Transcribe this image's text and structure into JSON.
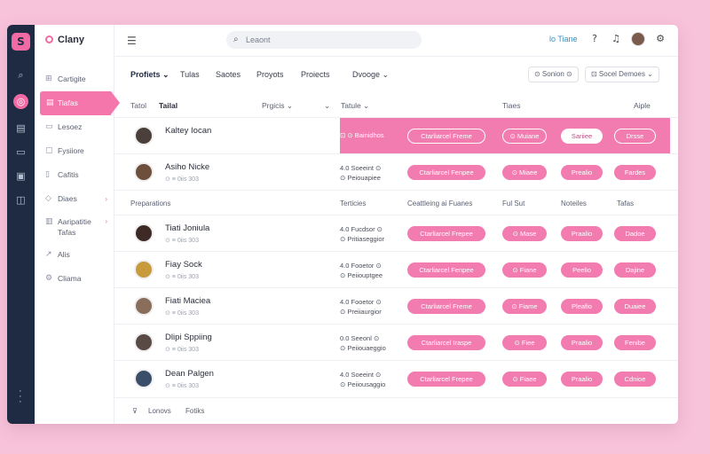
{
  "app": {
    "name": "Clany",
    "logo_letter": "S"
  },
  "topbar": {
    "search_placeholder": "Leaont",
    "link": "lo Tiane"
  },
  "sidebar": {
    "items": [
      {
        "label": "Cartigite",
        "icon": "grid-icon"
      },
      {
        "label": "Tiafas",
        "icon": "document-icon",
        "active": true
      },
      {
        "label": "Lesoez",
        "icon": "folder-icon"
      },
      {
        "label": "Fysiiore",
        "icon": "box-icon"
      },
      {
        "label": "Cafitis",
        "icon": "file-icon"
      },
      {
        "label": "Diaes",
        "icon": "tag-icon",
        "chevron": "›"
      },
      {
        "label": "Aaripatitie",
        "label2": "Tafas",
        "icon": "chart-icon",
        "chevron": "›"
      },
      {
        "label": "Alis",
        "icon": "link-icon"
      },
      {
        "label": "Cliama",
        "icon": "settings-icon"
      }
    ]
  },
  "tabs": [
    {
      "label": "Profiets ⌄",
      "active": true
    },
    {
      "label": "Tulas"
    },
    {
      "label": "Saotes"
    },
    {
      "label": "Proyots"
    },
    {
      "label": "Proiects"
    },
    {
      "label": "Dvooge ⌄"
    }
  ],
  "tab_buttons": [
    "⊙ Sonion ⊙",
    "⊡ Socel Demoes ⌄"
  ],
  "table": {
    "headers": [
      "Tatol",
      "Tailal",
      "Prgicis ⌄",
      "⌄",
      "Tatule ⌄",
      "Tiaes",
      "Aiple"
    ],
    "subheaders": [
      "Preparations",
      "Terticies",
      "Ceattleing ai Fuanes",
      "Ful Sut",
      "Noteiles",
      "Tafas"
    ],
    "footer": [
      "⊽",
      "Lonovs",
      "Fotiks"
    ],
    "rows": [
      {
        "name": "Kaltey Iocan",
        "sub": "",
        "status1": "⊡ ⊙ Bainidhos",
        "status2": "",
        "chips": [
          "Ctarliarcel Freme",
          "⊙ Muiane",
          "Sariiee",
          "Drsse"
        ],
        "highlight": true,
        "avatar_color": "#4a3f3a"
      },
      {
        "name": "Asiho Nicke",
        "sub": "⊙ ≡ 0iis 303",
        "status1": "4.0 Soeeint ⊙",
        "status2": "⊙ Peiouapiee",
        "chips": [
          "Ctarliarcel Fenpee",
          "⊙ Miaee",
          "Prealio",
          "Fardes"
        ],
        "avatar_color": "#6d4f3b"
      },
      {
        "name": "Tiati Joniula",
        "sub": "⊙ ≡ 0iis 303",
        "status1": "4.0 Fucdsor ⊙",
        "status2": "⊙ Pritiaseggior",
        "chips": [
          "Ctarliarcel Frepee",
          "⊙ Mase",
          "Praalio",
          "Dadoe"
        ],
        "avatar_color": "#3d2a27"
      },
      {
        "name": "Fiay Sock",
        "sub": "⊙ ≡ 0iis 303",
        "status1": "4.0 Fooetor ⊙",
        "status2": "⊙ Peiiouptgee",
        "chips": [
          "Ctarliarcel Fenpee",
          "⊙ Fiane",
          "Peelio",
          "Dajine"
        ],
        "avatar_color": "#c79a3b"
      },
      {
        "name": "Fiati Maciea",
        "sub": "⊙ ≡ 0iis 303",
        "status1": "4.0 Fooetor ⊙",
        "status2": "⊙ Preiiaurgior",
        "chips": [
          "Ctarliarcel Freme",
          "⊙ Fiame",
          "Pleafio",
          "Duaiee"
        ],
        "avatar_color": "#8a6e5c"
      },
      {
        "name": "Dlipi Sppiing",
        "sub": "⊙ ≡ 0iis 303",
        "status1": "0.0 Seeonl ⊙",
        "status2": "⊙ Peiiouaeggio",
        "chips": [
          "Ctarliarcel Iraspe",
          "⊙ Fiee",
          "Praalio",
          "Fenibe"
        ],
        "avatar_color": "#5a4a45"
      },
      {
        "name": "Dean Palgen",
        "sub": "⊙ ≡ 0iis 303",
        "status1": "4.0 Soeeint ⊙",
        "status2": "⊙ Peiiousaggio",
        "chips": [
          "Ctarliarcel Frepee",
          "⊙ Fiaee",
          "Praalio",
          "Cdnioe"
        ],
        "avatar_color": "#3a4e6a"
      }
    ]
  }
}
